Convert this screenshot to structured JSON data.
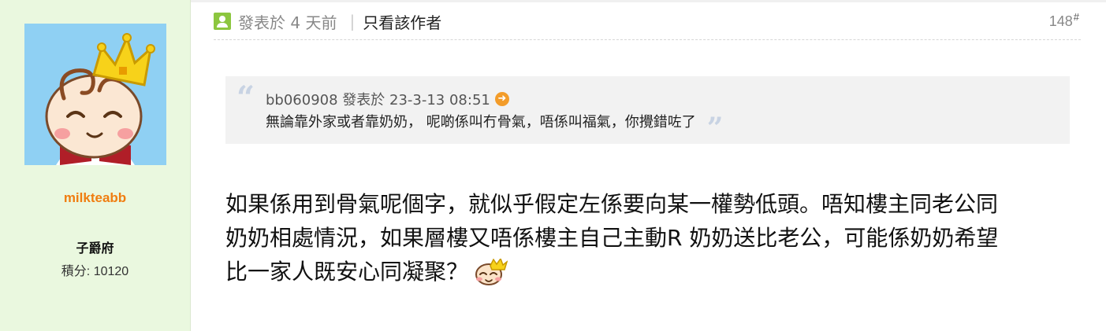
{
  "author": {
    "username": "milkteabb",
    "rank": "子爵府",
    "points": "積分: 10120",
    "avatar_icon": "baby-with-crown-avatar"
  },
  "meta": {
    "posted": "發表於 4 天前",
    "separator": "|",
    "only_author": "只看該作者",
    "floor_number": "148",
    "floor_mark": "#",
    "user_icon": "user-icon"
  },
  "quote": {
    "open_mark": "“",
    "close_mark": "”",
    "header": "bb060908 發表於 23-3-13 08:51",
    "text": "無論靠外家或者靠奶奶， 呢啲係叫冇骨氣，唔係叫福氣，你攪錯咗了",
    "jump_icon": "jump-to-post-icon"
  },
  "content": {
    "lines": [
      "如果係用到骨氣呢個字，就似乎假定左係要向某一權勢低頭。唔知樓主同老公同",
      "奶奶相處情況，如果層樓又唔係樓主自己主動R 奶奶送比老公，可能係奶奶希望",
      "比一家人既安心同凝聚？"
    ],
    "emoji_icon": "baby-crown-smiley-icon"
  },
  "colors": {
    "sidebar_bg": "#eaf8df",
    "username": "#f07d10",
    "user_icon": "#8cc63f",
    "quote_bg": "#f2f2f2",
    "jump_icon": "#f39c2a"
  }
}
